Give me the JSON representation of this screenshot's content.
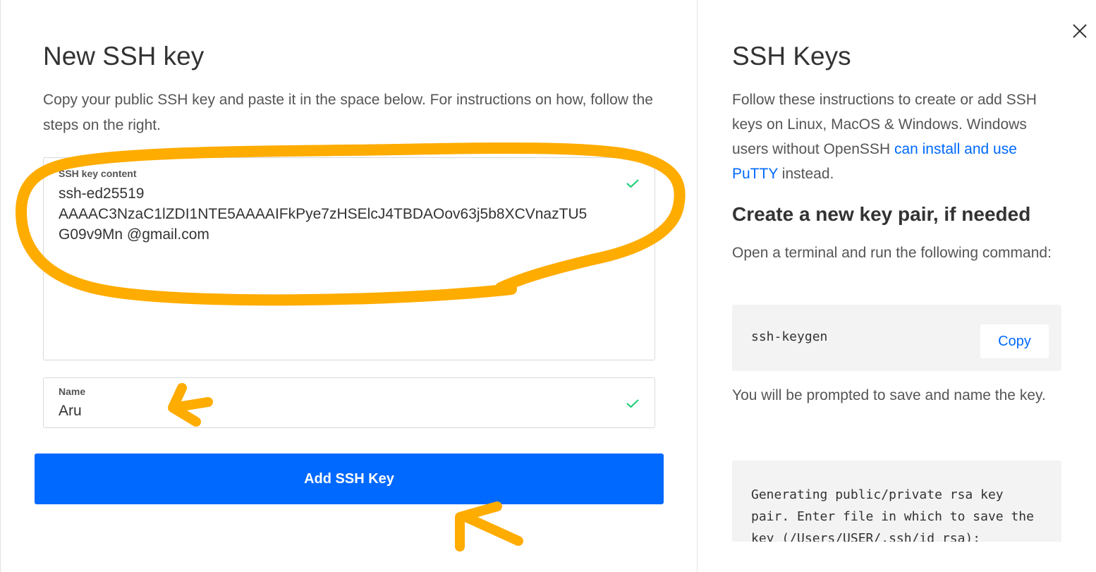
{
  "left_panel": {
    "title": "New SSH key",
    "description": "Copy your public SSH key and paste it in the space below. For instructions on how, follow the steps on the right.",
    "ssh_key_field": {
      "label": "SSH key content",
      "value": "ssh-ed25519\nAAAAC3NzaC1lZDI1NTE5AAAAIFkPye7zHSElcJ4TBDAOov63j5b8XCVnazTU5\nG09v9Mn                    @gmail.com"
    },
    "name_field": {
      "label": "Name",
      "value": "Aru"
    },
    "submit_label": "Add SSH Key"
  },
  "right_panel": {
    "title": "SSH Keys",
    "intro_text": "Follow these instructions to create or add SSH keys on Linux, MacOS & Windows. Windows users without OpenSSH ",
    "intro_link": "can install and use PuTTY",
    "intro_suffix": " instead.",
    "section_title": "Create a new key pair, if needed",
    "step_text": "Open a terminal and run the following command:",
    "command": "ssh-keygen",
    "copy_label": "Copy",
    "prompt_text": "You will be prompted to save and name the key.",
    "output": "Generating public/private rsa key pair. Enter file in which to save the key (/Users/USER/.ssh/id_rsa):"
  },
  "colors": {
    "accent": "#0069ff",
    "check": "#15cd72",
    "annotation": "#ffac00"
  },
  "icons": {
    "close": "close-icon",
    "valid": "check-icon"
  }
}
